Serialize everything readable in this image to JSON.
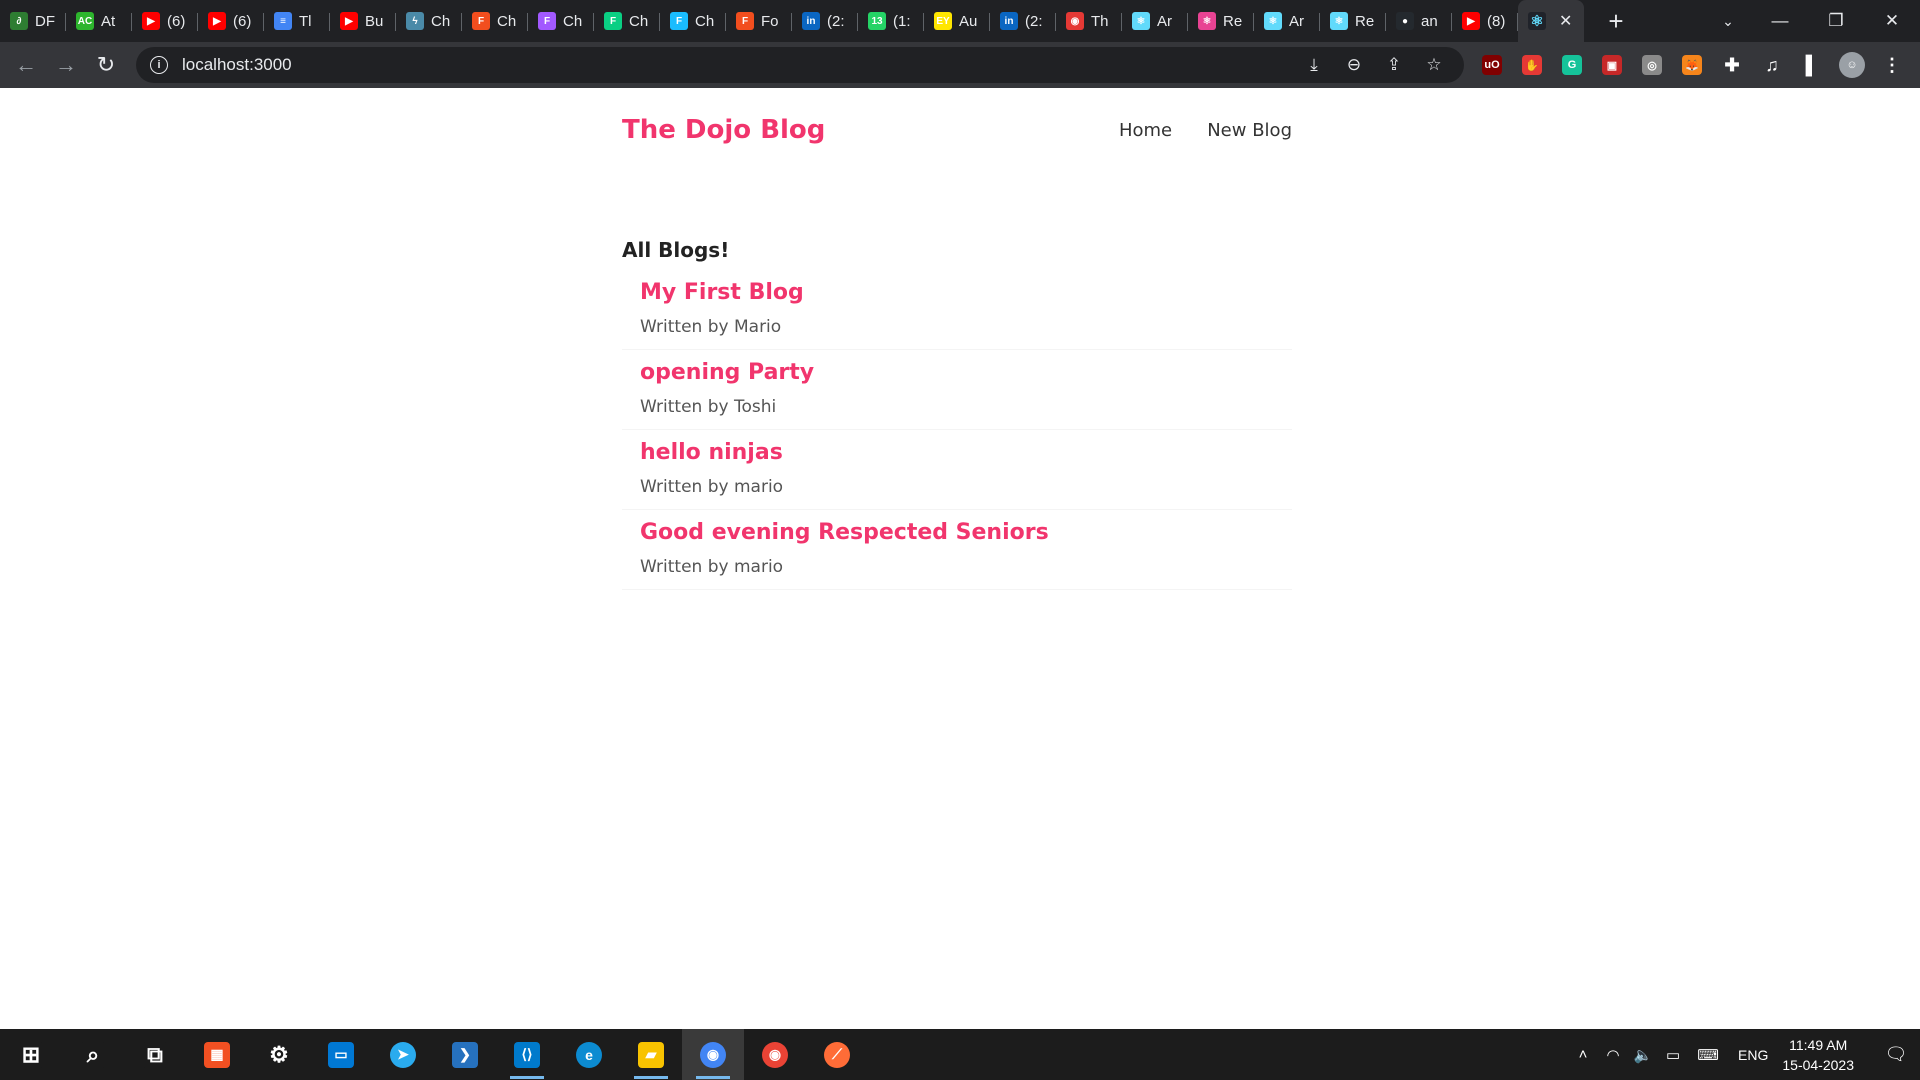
{
  "browser": {
    "tabs": [
      {
        "title": "DF",
        "icon": "df-icon",
        "color": "#2e7d32",
        "glyph": "∂"
      },
      {
        "title": "At",
        "icon": "atcoder-icon",
        "color": "#2db52d",
        "glyph": "AC"
      },
      {
        "title": "(6)",
        "icon": "youtube-icon",
        "color": "#ff0000",
        "glyph": "▶"
      },
      {
        "title": "(6)",
        "icon": "youtube-icon",
        "color": "#ff0000",
        "glyph": "▶"
      },
      {
        "title": "Tl",
        "icon": "google-docs-icon",
        "color": "#4285f4",
        "glyph": "≡"
      },
      {
        "title": "Bu",
        "icon": "youtube-icon",
        "color": "#ff0000",
        "glyph": "▶"
      },
      {
        "title": "Ch",
        "icon": "lightning-icon",
        "color": "#4a8aa8",
        "glyph": "ϟ"
      },
      {
        "title": "Ch",
        "icon": "figma-icon",
        "color": "#f24e1e",
        "glyph": "F"
      },
      {
        "title": "Ch",
        "icon": "figma-icon",
        "color": "#a259ff",
        "glyph": "F"
      },
      {
        "title": "Ch",
        "icon": "figma-icon",
        "color": "#0acf83",
        "glyph": "F"
      },
      {
        "title": "Ch",
        "icon": "figma-icon",
        "color": "#1abcfe",
        "glyph": "F"
      },
      {
        "title": "Fo",
        "icon": "figma-icon",
        "color": "#f24e1e",
        "glyph": "F"
      },
      {
        "title": "(2:",
        "icon": "linkedin-icon",
        "color": "#0a66c2",
        "glyph": "in"
      },
      {
        "title": "(1:",
        "icon": "whatsapp-icon",
        "color": "#25d366",
        "glyph": "13"
      },
      {
        "title": "Au",
        "icon": "ey-icon",
        "color": "#ffe600",
        "glyph": "EY"
      },
      {
        "title": "(2:",
        "icon": "linkedin-icon",
        "color": "#0a66c2",
        "glyph": "in"
      },
      {
        "title": "Th",
        "icon": "location-pin-icon",
        "color": "#e53935",
        "glyph": "◉"
      },
      {
        "title": "Ar",
        "icon": "react-icon",
        "color": "#61dafb",
        "glyph": "⚛"
      },
      {
        "title": "Re",
        "icon": "react-icon",
        "color": "#e84393",
        "glyph": "⚛"
      },
      {
        "title": "Ar",
        "icon": "react-icon",
        "color": "#61dafb",
        "glyph": "⚛"
      },
      {
        "title": "Re",
        "icon": "react-icon",
        "color": "#61dafb",
        "glyph": "⚛"
      },
      {
        "title": "an",
        "icon": "github-icon",
        "color": "#24292e",
        "glyph": "●"
      },
      {
        "title": "(8)",
        "icon": "youtube-icon",
        "color": "#ff0000",
        "glyph": "▶"
      }
    ],
    "active_tab": {
      "icon": "react-icon",
      "color": "#61dafb",
      "glyph": "⚛"
    },
    "new_tab": "+",
    "address": "localhost:3000",
    "extensions": [
      {
        "icon": "ublock-icon",
        "color": "#800000",
        "glyph": "uO"
      },
      {
        "icon": "hand-icon",
        "color": "#e53935",
        "glyph": "✋"
      },
      {
        "icon": "grammarly-icon",
        "color": "#15c39a",
        "glyph": "G"
      },
      {
        "icon": "red-square-icon",
        "color": "#c62828",
        "glyph": "▣"
      },
      {
        "icon": "glasses-icon",
        "color": "#8a8a8a",
        "glyph": "◎"
      },
      {
        "icon": "metamask-icon",
        "color": "#f6851b",
        "glyph": "🦊"
      },
      {
        "icon": "puzzle-icon",
        "color": "#5f6368",
        "glyph": "✚"
      },
      {
        "icon": "media-icon",
        "color": "#5f6368",
        "glyph": "♫"
      },
      {
        "icon": "sidepanel-icon",
        "color": "#5f6368",
        "glyph": "▌"
      },
      {
        "icon": "profile-avatar-icon",
        "color": "#9aa0a6",
        "glyph": "☺"
      },
      {
        "icon": "menu-dots-icon",
        "color": "#5f6368",
        "glyph": "⋮"
      }
    ]
  },
  "site": {
    "brand": "The Dojo Blog",
    "nav": [
      "Home",
      "New Blog"
    ],
    "heading": "All Blogs!",
    "blogs": [
      {
        "title": "My First Blog",
        "author": "Written by Mario"
      },
      {
        "title": "opening Party",
        "author": "Written by Toshi"
      },
      {
        "title": "hello ninjas",
        "author": "Written by mario"
      },
      {
        "title": "Good evening Respected Seniors",
        "author": "Written by mario"
      }
    ]
  },
  "taskbar": {
    "apps": [
      {
        "name": "start-icon",
        "color": "#1c1c1c",
        "glyph": "⊞"
      },
      {
        "name": "search-icon",
        "color": "#1c1c1c",
        "glyph": "⌕"
      },
      {
        "name": "task-view-icon",
        "color": "#1c1c1c",
        "glyph": "⧉"
      },
      {
        "name": "store-icon",
        "color": "#f25022",
        "glyph": "▦"
      },
      {
        "name": "settings-icon",
        "color": "#1c1c1c",
        "glyph": "⚙"
      },
      {
        "name": "blue-app-icon",
        "color": "#0078d4",
        "glyph": "▭"
      },
      {
        "name": "telegram-icon",
        "color": "#2aabee",
        "glyph": "➤"
      },
      {
        "name": "powershell-icon",
        "color": "#2671be",
        "glyph": "❯"
      },
      {
        "name": "vscode-icon",
        "color": "#007acc",
        "glyph": "⟨⟩",
        "running": true
      },
      {
        "name": "edge-icon",
        "color": "#0c8bd1",
        "glyph": "e"
      },
      {
        "name": "file-explorer-icon",
        "color": "#f8c300",
        "glyph": "▰",
        "running": true
      },
      {
        "name": "chrome-icon",
        "color": "#4285f4",
        "glyph": "◉",
        "running": true,
        "active": true
      },
      {
        "name": "chrome-icon",
        "color": "#ea4335",
        "glyph": "◉"
      },
      {
        "name": "postman-icon",
        "color": "#ff6c37",
        "glyph": "⟋"
      }
    ],
    "language": "ENG",
    "time": "11:49 AM",
    "date": "15-04-2023"
  }
}
